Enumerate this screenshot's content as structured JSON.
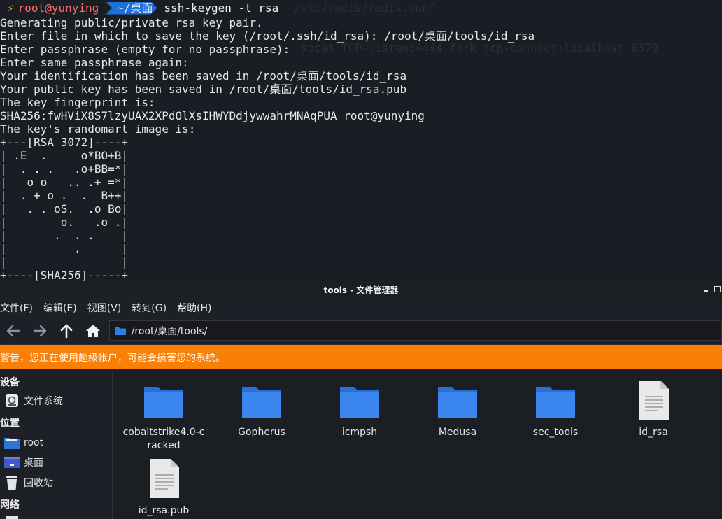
{
  "terminal": {
    "background_ghost_1": "/etc/redis/redis.conf",
    "background_ghost_2": "socat TCP-listen:4444,fork tcp-connect:localhost:6379",
    "prompt": {
      "bolt": "⚡",
      "user": "root@yunying",
      "dir": "~/桌面",
      "command": "ssh-keygen -t rsa"
    },
    "lines": [
      "Generating public/private rsa key pair.",
      "Enter file in which to save the key (/root/.ssh/id_rsa): /root/桌面/tools/id_rsa",
      "Enter passphrase (empty for no passphrase):",
      "Enter same passphrase again:",
      "Your identification has been saved in /root/桌面/tools/id_rsa",
      "Your public key has been saved in /root/桌面/tools/id_rsa.pub",
      "The key fingerprint is:",
      "SHA256:fwHViX8S7lzyUAX2XPdOlXsIHWYDdjywwahrMNAqPUA root@yunying",
      "The key's randomart image is:",
      "+---[RSA 3072]----+",
      "| .E  .     o*BO+B|",
      "|  . . .   .o+BB=*|",
      "|   o o   .. .+ =*|",
      "|  . + o .  .  B++|",
      "|   . . oS.  .o Bo|",
      "|        o.   .o .|",
      "|       .  . .    |",
      "|          .      |",
      "|                 |",
      "+----[SHA256]-----+"
    ]
  },
  "file_manager": {
    "window_title": "tools - 文件管理器",
    "menu": [
      "文件(F)",
      "编辑(E)",
      "视图(V)",
      "转到(G)",
      "帮助(H)"
    ],
    "path": "/root/桌面/tools/",
    "warning": "警告，您正在使用超级帐户，可能会损害您的系统。",
    "sidebar": {
      "devices_header": "设备",
      "filesystem": "文件系统",
      "places_header": "位置",
      "root": "root",
      "desktop": "桌面",
      "trash": "回收站",
      "network_header": "网络"
    },
    "files": [
      {
        "name": "cobaltstrike4.0-cracked",
        "type": "folder"
      },
      {
        "name": "Gopherus",
        "type": "folder"
      },
      {
        "name": "icmpsh",
        "type": "folder"
      },
      {
        "name": "Medusa",
        "type": "folder"
      },
      {
        "name": "sec_tools",
        "type": "folder"
      },
      {
        "name": "id_rsa",
        "type": "file"
      },
      {
        "name": "id_rsa.pub",
        "type": "file"
      }
    ],
    "colors": {
      "folder": "#2f7be8",
      "warning_bar": "#fa7f07",
      "prompt_dir": "#1f6fd8",
      "prompt_user": "#ff7063"
    }
  }
}
